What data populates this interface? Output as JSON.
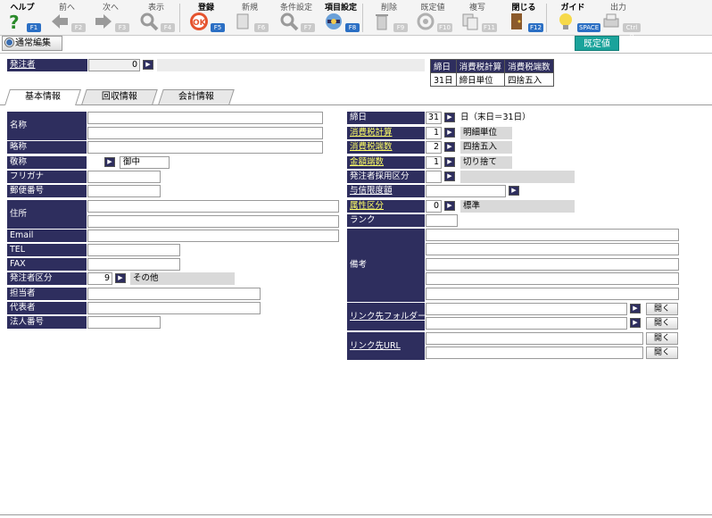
{
  "toolbar": {
    "buttons": [
      {
        "label": "ヘルプ",
        "key": "F1",
        "icon": "help-icon",
        "active": true
      },
      {
        "label": "前へ",
        "key": "F2",
        "icon": "prev-arrow-icon",
        "active": false
      },
      {
        "label": "次へ",
        "key": "F3",
        "icon": "next-arrow-icon",
        "active": false
      },
      {
        "label": "表示",
        "key": "F4",
        "icon": "search-icon",
        "active": false
      },
      {
        "label": "登録",
        "key": "F5",
        "icon": "ok-icon",
        "active": true
      },
      {
        "label": "新規",
        "key": "F6",
        "icon": "new-doc-icon",
        "active": false
      },
      {
        "label": "条件設定",
        "key": "F7",
        "icon": "condition-search-icon",
        "active": false
      },
      {
        "label": "項目設定",
        "key": "F8",
        "icon": "item-settings-icon",
        "active": true
      },
      {
        "label": "削除",
        "key": "F9",
        "icon": "trash-icon",
        "active": false
      },
      {
        "label": "既定値",
        "key": "F10",
        "icon": "default-value-icon",
        "active": false
      },
      {
        "label": "複写",
        "key": "F11",
        "icon": "copy-icon",
        "active": false
      },
      {
        "label": "閉じる",
        "key": "F12",
        "icon": "close-door-icon",
        "active": true
      },
      {
        "label": "ガイド",
        "key": "SPACE",
        "icon": "guide-bulb-icon",
        "active": true
      },
      {
        "label": "出力",
        "key": "Ctrl P",
        "icon": "output-print-icon",
        "active": false
      }
    ]
  },
  "mode": {
    "label": "通常編集"
  },
  "default_button": {
    "label": "既定値"
  },
  "orderer": {
    "label": "発注者",
    "value": "0"
  },
  "summary": {
    "headers": [
      "締日",
      "消費税計算",
      "消費税端数"
    ],
    "row": [
      "31日",
      "締日単位",
      "四捨五入"
    ]
  },
  "tabs": [
    "基本情報",
    "回収情報",
    "会計情報"
  ],
  "left": {
    "name_label": "名称",
    "short_label": "略称",
    "honorific_label": "敬称",
    "honorific_value": "御中",
    "furigana_label": "フリガナ",
    "postal_label": "郵便番号",
    "address_label": "住所",
    "email_label": "Email",
    "tel_label": "TEL",
    "fax_label": "FAX",
    "type_label": "発注者区分",
    "type_value": "9",
    "type_text": "その他",
    "person_label": "担当者",
    "rep_label": "代表者",
    "corp_label": "法人番号"
  },
  "right": {
    "closing_label": "締日",
    "closing_value": "31",
    "closing_note": "日（末日＝31日）",
    "taxcalc_label": "消費税計算",
    "taxcalc_value": "1",
    "taxcalc_text": "明細単位",
    "taxfrac_label": "消費税端数",
    "taxfrac_value": "2",
    "taxfrac_text": "四捨五入",
    "amtfrac_label": "金額端数",
    "amtfrac_value": "1",
    "amtfrac_text": "切り捨て",
    "adopt_label": "発注者採用区分",
    "credit_label": "与信限度額",
    "attr_label": "属性区分",
    "attr_value": "0",
    "attr_text": "標準",
    "rank_label": "ランク",
    "note_label": "備考",
    "folder_label": "リンク先フォルダー",
    "url_label": "リンク先URL",
    "ref_label": "開く"
  }
}
